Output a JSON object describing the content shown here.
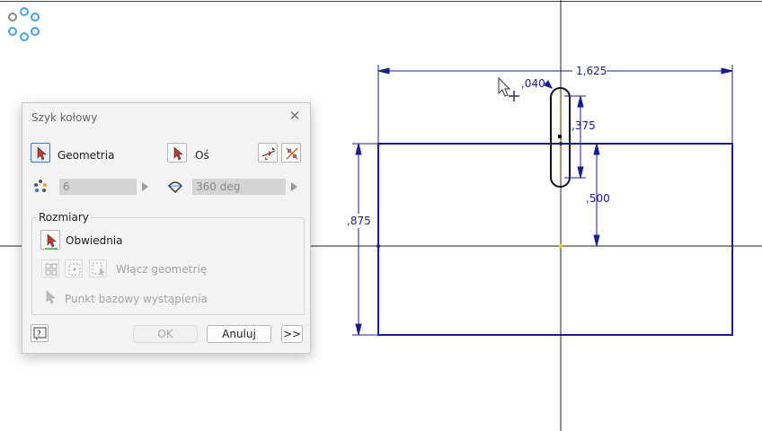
{
  "drawing": {
    "dimensions": {
      "width": "1,625",
      "slot_width": ",040",
      "slot_offset": ",375",
      "slot_height": ",500",
      "height": ",875"
    },
    "colors": {
      "sketch_line": "#1c1c8c",
      "axis_line": "#222222",
      "slot_outline": "#111111",
      "centerline": "#e8a030"
    }
  },
  "dialog": {
    "title": "Szyk kołowy",
    "geometry_label": "Geometria",
    "axis_label": "Oś",
    "count_value": "6",
    "angle_value": "360 deg",
    "group_title": "Rozmiary",
    "envelope_label": "Obwiednia",
    "enable_geometry_label": "Włącz geometrię",
    "base_point_label": "Punkt bazowy wystąpienia",
    "ok_label": "OK",
    "cancel_label": "Anuluj",
    "more_label": ">>",
    "accent_color": "#3b78c4"
  }
}
